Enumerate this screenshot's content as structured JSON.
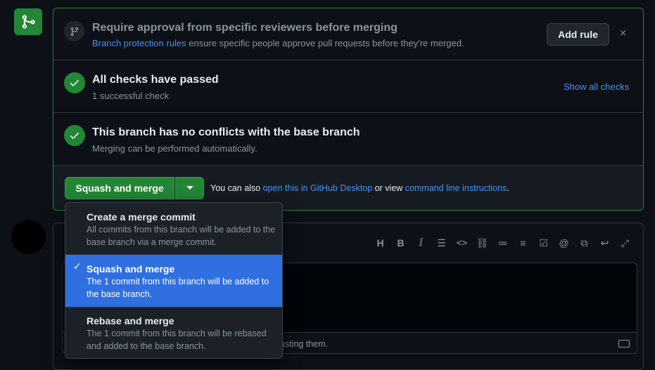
{
  "protection": {
    "title": "Require approval from specific reviewers before merging",
    "link": "Branch protection rules",
    "desc": " ensure specific people approve pull requests before they're merged.",
    "add_rule": "Add rule",
    "close": "×"
  },
  "checks": {
    "title": "All checks have passed",
    "sub": "1 successful check",
    "show_all": "Show all checks"
  },
  "conflicts": {
    "title": "This branch has no conflicts with the base branch",
    "sub": "Merging can be performed automatically."
  },
  "merge": {
    "button": "Squash and merge",
    "also_prefix": "You can also ",
    "desktop_link": "open this in GitHub Desktop",
    "or_view": " or view ",
    "cli_link": "command line instructions",
    "suffix": "."
  },
  "menu": {
    "items": [
      {
        "title": "Create a merge commit",
        "desc": "All commits from this branch will be added to the base branch via a merge commit.",
        "selected": false
      },
      {
        "title": "Squash and merge",
        "desc": "The 1 commit from this branch will be added to the base branch.",
        "selected": true
      },
      {
        "title": "Rebase and merge",
        "desc": "The 1 commit from this branch will be rebased and added to the base branch.",
        "selected": false
      }
    ]
  },
  "comment": {
    "footer_text": "asting them."
  },
  "colors": {
    "accent_green": "#238636",
    "link_blue": "#4493f8",
    "selected_blue": "#2f6fe0"
  }
}
